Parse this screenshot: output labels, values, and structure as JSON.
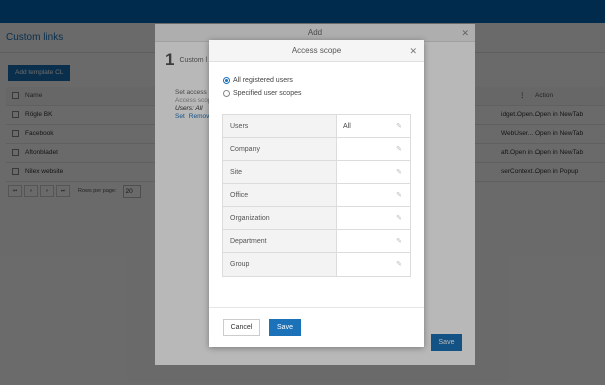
{
  "page": {
    "title": "Custom links",
    "add_button": "Add template CL",
    "table": {
      "header": {
        "name": "Name",
        "action": "Action"
      },
      "rows": [
        {
          "name": "Rögle BK",
          "url": "idget.Open...",
          "action": "Open in NewTab"
        },
        {
          "name": "Facebook",
          "url": "WebUser...",
          "action": "Open in NewTab"
        },
        {
          "name": "Aftonbladet",
          "url": "aft.Open in ...",
          "action": "Open in NewTab"
        },
        {
          "name": "Nilex website",
          "url": "serContext...",
          "action": "Open in Popup"
        }
      ]
    },
    "pager": {
      "first": "⏮",
      "prev": "«",
      "next": "»",
      "last": "⏭",
      "rows_label": "Rows per page:",
      "rows_value": "20"
    }
  },
  "add_dialog": {
    "title": "Add",
    "step_number": "1",
    "step_label": "Custom l",
    "set_access": "Set access",
    "access_scope": "Access scop",
    "users_all": "Users: All",
    "set_link": "Set",
    "remove_link": "Remov",
    "save": "Save"
  },
  "scope_dialog": {
    "title": "Access scope",
    "options": [
      {
        "label": "All registered users",
        "checked": true
      },
      {
        "label": "Specified user scopes",
        "checked": false
      }
    ],
    "rows": [
      {
        "label": "Users",
        "value": "All"
      },
      {
        "label": "Company",
        "value": ""
      },
      {
        "label": "Site",
        "value": ""
      },
      {
        "label": "Office",
        "value": ""
      },
      {
        "label": "Organization",
        "value": ""
      },
      {
        "label": "Department",
        "value": ""
      },
      {
        "label": "Group",
        "value": ""
      }
    ],
    "cancel": "Cancel",
    "save": "Save"
  },
  "colors": {
    "brand": "#1b72b8",
    "topbar": "#0068b8"
  }
}
